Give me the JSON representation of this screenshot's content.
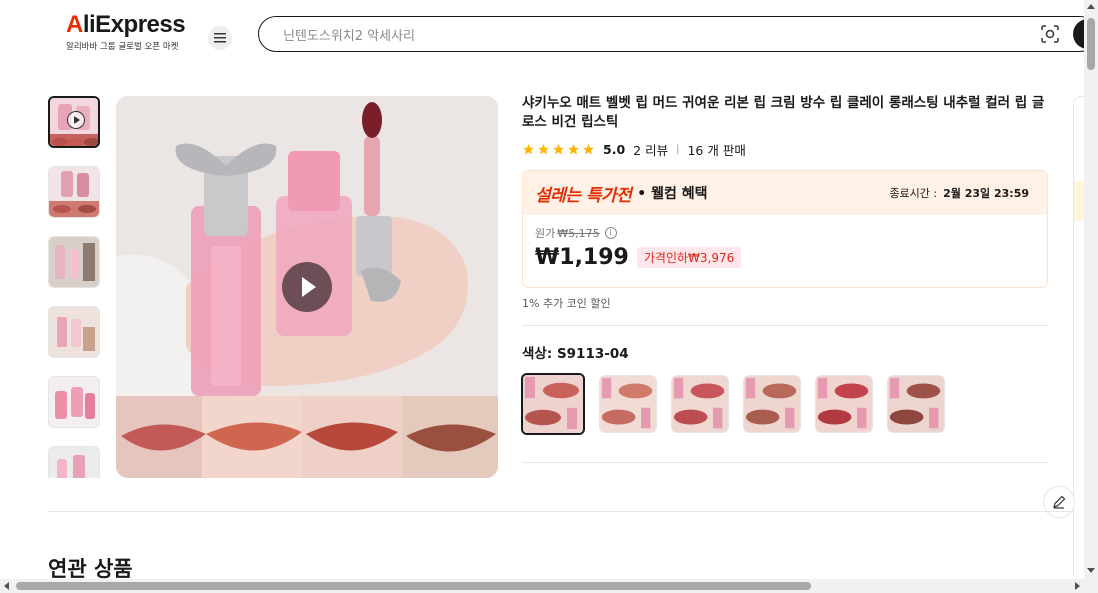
{
  "header": {
    "logo_text_a": "A",
    "logo_text_rest": "liExpress",
    "logo_subtitle": "알리바바 그룹 글로벌 오픈 마켓",
    "search_placeholder": "닌텐도스위치2 악세사리"
  },
  "product": {
    "title": "샤키누오 매트 벨벳 립 머드 귀여운 리본 립 크림 방수 립 클레이 롱래스팅 내추럴 컬러 립 글로스 비건 립스틱",
    "rating_score": "5.0",
    "reviews": "2 리뷰",
    "sold": "16 개 판매",
    "stars": 5
  },
  "deal": {
    "brand": "설레는 특가전",
    "welcome": "• 웰컴 혜택",
    "end_label": "종료시간 :",
    "end_time": "2월 23일 23:59",
    "original_label": "원가",
    "original_price": "₩5,175",
    "price": "₩1,199",
    "discount": "가격인하₩3,976",
    "coin": "1% 추가 코인 할인"
  },
  "variant": {
    "label": "색상: S9113-04",
    "count": 6,
    "selected_index": 0
  },
  "section": {
    "related_title": "연관 상품"
  },
  "colors": {
    "accent": "#e62e04",
    "star": "#fdb300",
    "discount_bg": "#fde7ea",
    "deal_bg": "#fff1e6"
  }
}
